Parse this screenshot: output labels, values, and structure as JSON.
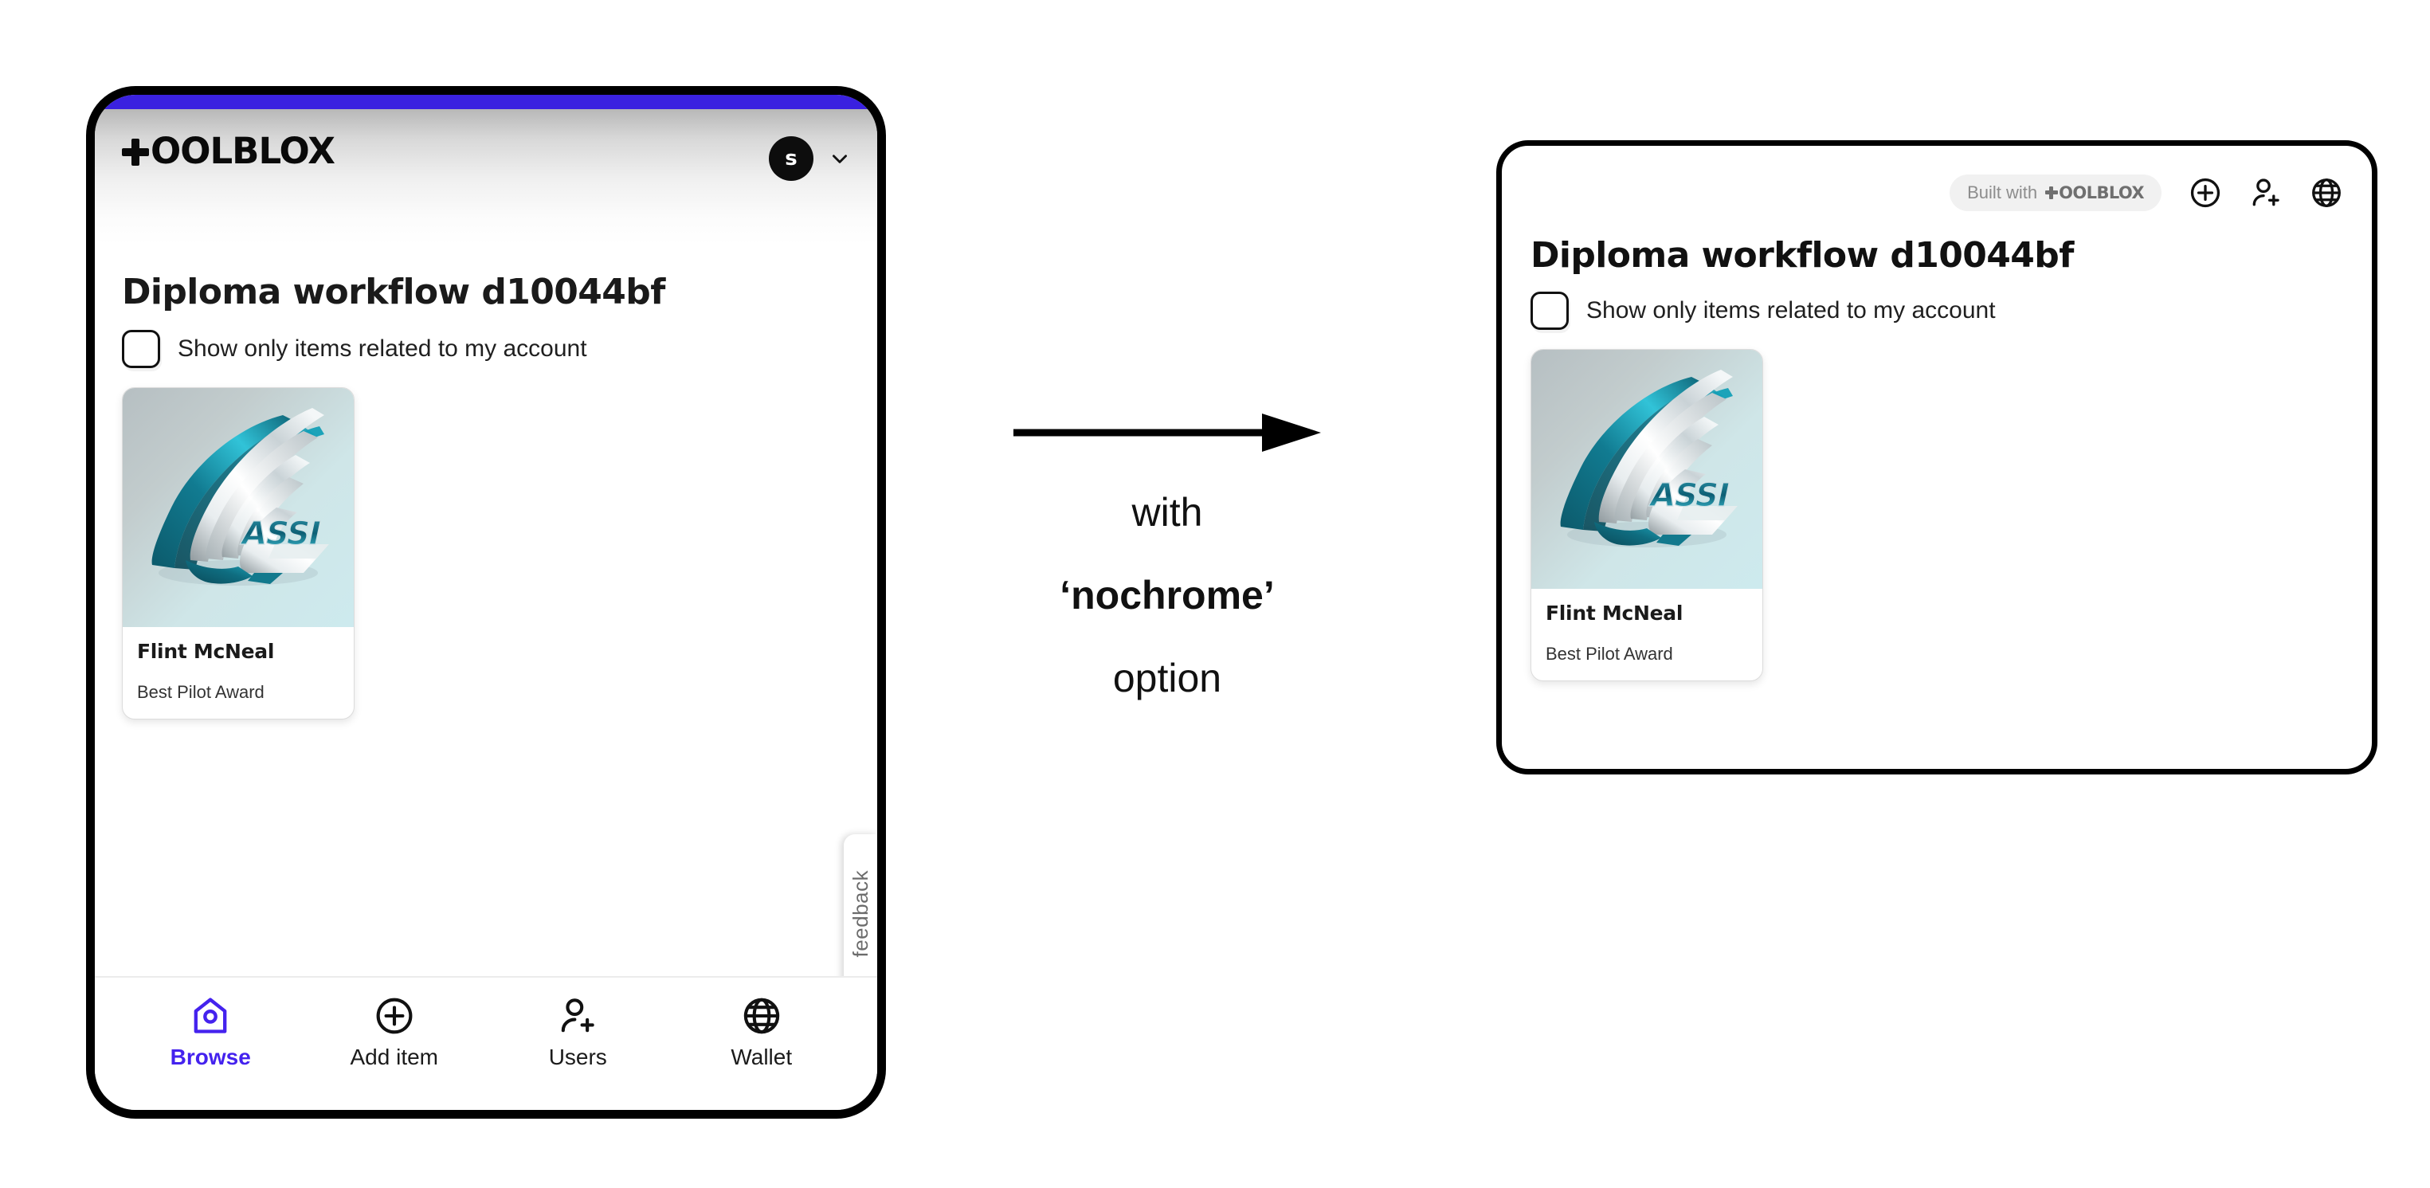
{
  "theme": {
    "accent_purple": "#3a21e0",
    "browse_active": "#4422ee",
    "frame_black": "#000000",
    "card_image_bg_start": "#b6bfc2",
    "card_image_bg_end": "#cdeaee"
  },
  "phone": {
    "header": {
      "brand_name": "OOLBLOX",
      "brand_plus_icon": "plus-icon",
      "avatar_initial": "s",
      "chevron_icon": "chevron-down-icon"
    },
    "page_title": "Diploma workflow d10044bf",
    "filter": {
      "checkbox_checked": false,
      "label": "Show only items related to my account"
    },
    "card": {
      "title": "Flint McNeal",
      "subtitle": "Best Pilot Award",
      "image_alt": "ASSI winged emblem",
      "image_wordmark": "ASSI"
    },
    "feedback_tab_label": "feedback",
    "nav": {
      "items": [
        {
          "label": "Browse",
          "icon": "home-pin-icon",
          "active": true
        },
        {
          "label": "Add item",
          "icon": "plus-circle-icon",
          "active": false
        },
        {
          "label": "Users",
          "icon": "user-plus-icon",
          "active": false
        },
        {
          "label": "Wallet",
          "icon": "globe-icon",
          "active": false
        }
      ]
    }
  },
  "annotation": {
    "arrow_icon": "right-arrow-icon",
    "line1": "with",
    "line2": "‘nochrome’",
    "line3": "option"
  },
  "nochrome": {
    "badge": {
      "prefix": "Built with",
      "brand_name": "OOLBLOX",
      "brand_plus_icon": "plus-icon"
    },
    "actions": [
      {
        "icon": "plus-circle-icon",
        "name": "add-item-icon"
      },
      {
        "icon": "user-plus-icon",
        "name": "users-icon"
      },
      {
        "icon": "globe-icon",
        "name": "wallet-icon"
      }
    ],
    "page_title": "Diploma workflow d10044bf",
    "filter": {
      "checkbox_checked": false,
      "label": "Show only items related to my account"
    },
    "card": {
      "title": "Flint McNeal",
      "subtitle": "Best Pilot Award",
      "image_alt": "ASSI winged emblem",
      "image_wordmark": "ASSI"
    }
  }
}
